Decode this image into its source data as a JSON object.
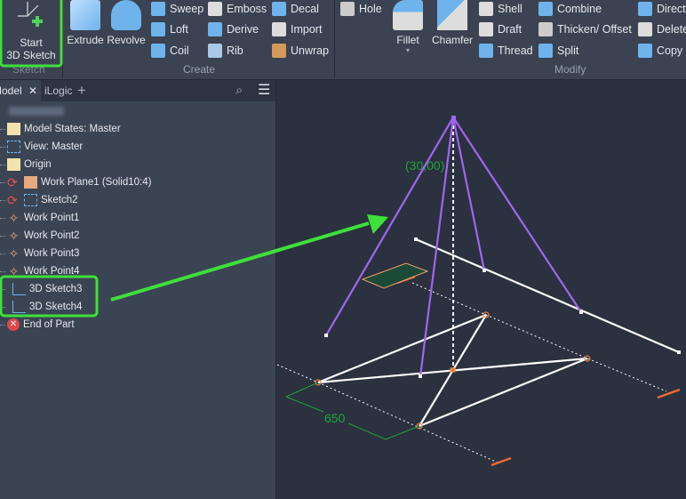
{
  "ribbon": {
    "sketch": {
      "start_label_1": "Start",
      "start_label_2": "3D Sketch",
      "group": "Sketch"
    },
    "create": {
      "group": "Create",
      "extrude": "Extrude",
      "revolve": "Revolve",
      "sweep": "Sweep",
      "loft": "Loft",
      "coil": "Coil",
      "emboss": "Emboss",
      "derive": "Derive",
      "rib": "Rib",
      "decal": "Decal",
      "import": "Import",
      "unwrap": "Unwrap"
    },
    "modify": {
      "group": "Modify",
      "hole": "Hole",
      "fillet": "Fillet",
      "chamfer": "Chamfer",
      "shell": "Shell",
      "draft": "Draft",
      "thread": "Thread",
      "combine": "Combine",
      "thicken": "Thicken/ Offset",
      "split": "Split",
      "direct": "Direct",
      "delete": "Delete",
      "copy": "Copy"
    }
  },
  "browser": {
    "tabs": [
      {
        "label": "Model"
      },
      {
        "label": "iLogic"
      }
    ],
    "items": [
      {
        "label": "Model States: Master"
      },
      {
        "label": "View: Master"
      },
      {
        "label": "Origin"
      },
      {
        "label": "Work Plane1 (Solid10:4)"
      },
      {
        "label": "Sketch2"
      },
      {
        "label": "Work Point1"
      },
      {
        "label": "Work Point2"
      },
      {
        "label": "Work Point3"
      },
      {
        "label": "Work Point4"
      },
      {
        "label": "3D Sketch3"
      },
      {
        "label": "3D Sketch4"
      },
      {
        "label": "End of Part"
      }
    ]
  },
  "viewport": {
    "angle_dim": "(30,00)",
    "length_dim": "650"
  },
  "colors": {
    "highlight": "#3ee03a",
    "sketch_purple": "#a066f0",
    "dim_green": "#1fa33a",
    "point_orange": "#f08040"
  }
}
